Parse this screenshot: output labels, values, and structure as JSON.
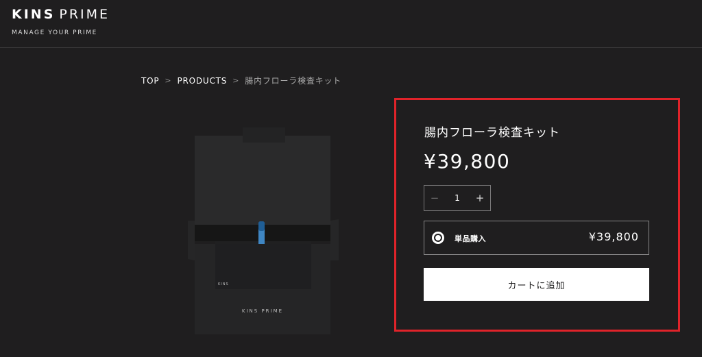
{
  "header": {
    "logo_primary": "KINS",
    "logo_secondary": "PRIME",
    "tagline": "MANAGE YOUR PRIME"
  },
  "breadcrumb": {
    "items": [
      "TOP",
      "PRODUCTS"
    ],
    "separator": ">",
    "current": "腸内フローラ検査キット"
  },
  "product": {
    "image_brand_text": "KINS PRIME",
    "image_small_text": "KINS",
    "title": "腸内フローラ検査キット",
    "price": "¥39,800",
    "quantity": {
      "minus_label": "−",
      "value": "1",
      "plus_label": "+"
    },
    "purchase_option": {
      "label": "単品購入",
      "price": "¥39,800",
      "selected": true
    },
    "add_to_cart_label": "カートに追加"
  },
  "colors": {
    "background": "#1f1e1f",
    "highlight_border": "#e0232a",
    "button_background": "#ffffff",
    "text": "#ffffff"
  }
}
